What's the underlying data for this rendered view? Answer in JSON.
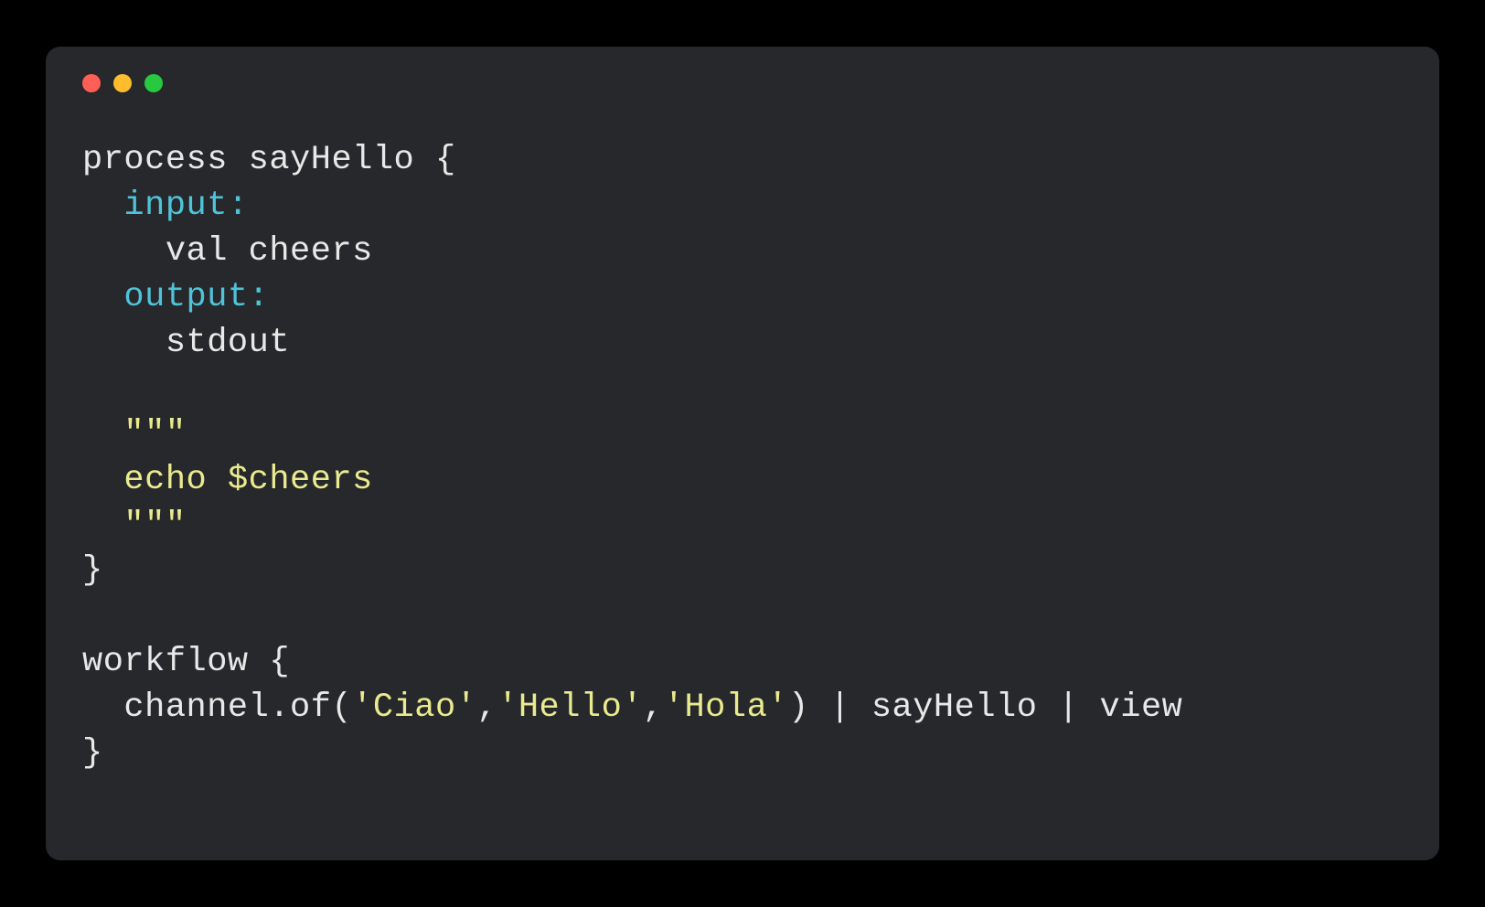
{
  "colors": {
    "traffic_red": "#ff5f56",
    "traffic_yellow": "#ffbd2e",
    "traffic_green": "#27c93f",
    "bg": "#27282b",
    "text_plain": "#e8e8e8",
    "text_keyword": "#4fc3d9",
    "text_string": "#eaea8f"
  },
  "code": {
    "lines": [
      [
        {
          "t": "process sayHello {",
          "c": "plain"
        }
      ],
      [
        {
          "t": "  ",
          "c": "plain"
        },
        {
          "t": "input:",
          "c": "keyword"
        }
      ],
      [
        {
          "t": "    val cheers",
          "c": "plain"
        }
      ],
      [
        {
          "t": "  ",
          "c": "plain"
        },
        {
          "t": "output:",
          "c": "keyword"
        }
      ],
      [
        {
          "t": "    stdout",
          "c": "plain"
        }
      ],
      [
        {
          "t": " ",
          "c": "plain"
        }
      ],
      [
        {
          "t": "  ",
          "c": "plain"
        },
        {
          "t": "\"\"\"",
          "c": "string"
        }
      ],
      [
        {
          "t": "  ",
          "c": "plain"
        },
        {
          "t": "echo $cheers",
          "c": "string"
        }
      ],
      [
        {
          "t": "  ",
          "c": "plain"
        },
        {
          "t": "\"\"\"",
          "c": "string"
        }
      ],
      [
        {
          "t": "}",
          "c": "plain"
        }
      ],
      [
        {
          "t": " ",
          "c": "plain"
        }
      ],
      [
        {
          "t": "workflow {",
          "c": "plain"
        }
      ],
      [
        {
          "t": "  channel.of(",
          "c": "plain"
        },
        {
          "t": "'Ciao'",
          "c": "string"
        },
        {
          "t": ",",
          "c": "plain"
        },
        {
          "t": "'Hello'",
          "c": "string"
        },
        {
          "t": ",",
          "c": "plain"
        },
        {
          "t": "'Hola'",
          "c": "string"
        },
        {
          "t": ") | sayHello | view",
          "c": "plain"
        }
      ],
      [
        {
          "t": "}",
          "c": "plain"
        }
      ]
    ]
  }
}
